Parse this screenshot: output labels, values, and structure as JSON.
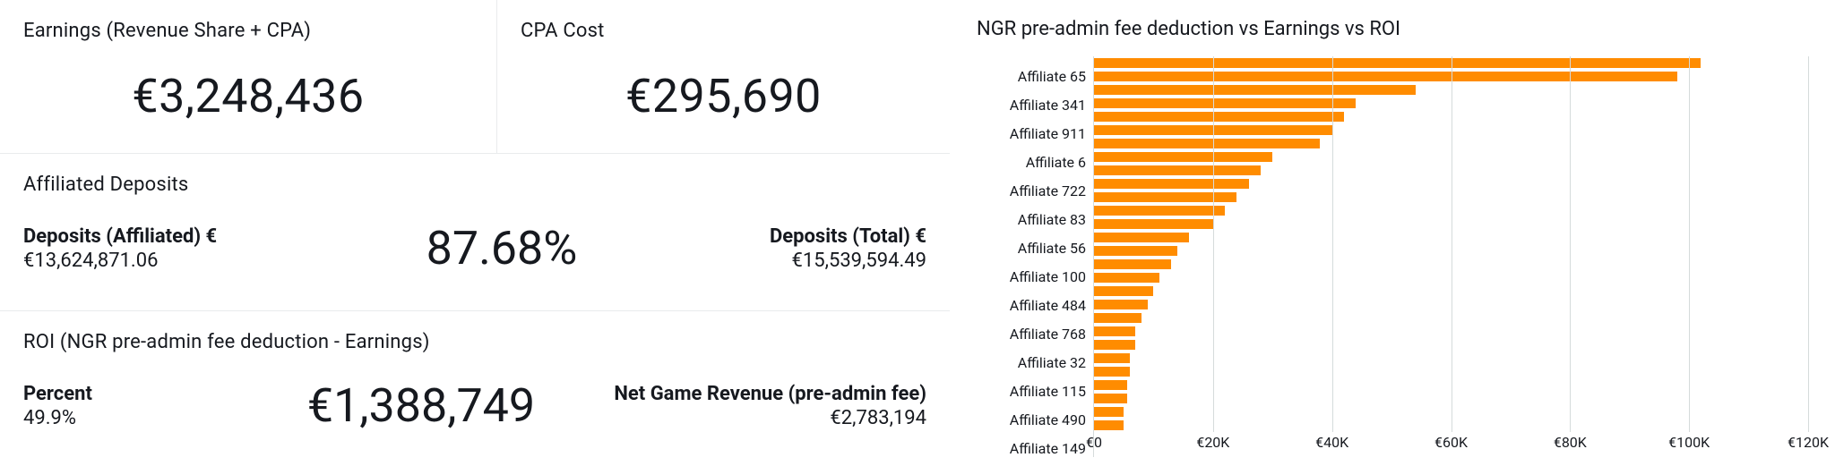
{
  "cards": {
    "earnings": {
      "title": "Earnings (Revenue Share + CPA)",
      "value": "€3,248,436"
    },
    "cpa": {
      "title": "CPA Cost",
      "value": "€295,690"
    }
  },
  "deposits": {
    "title": "Affiliated Deposits",
    "affiliated_label": "Deposits (Affiliated) €",
    "affiliated_value": "€13,624,871.06",
    "percent": "87.68%",
    "total_label": "Deposits (Total) €",
    "total_value": "€15,539,594.49"
  },
  "roi": {
    "title": "ROI (NGR pre-admin fee deduction - Earnings)",
    "percent_label": "Percent",
    "percent_value": "49.9%",
    "amount": "€1,388,749",
    "ngr_label": "Net Game Revenue (pre-admin fee)",
    "ngr_value": "€2,783,194"
  },
  "chart_title": "NGR pre-admin fee deduction vs Earnings vs ROI",
  "chart_data": {
    "type": "bar",
    "orientation": "horizontal",
    "title": "NGR pre-admin fee deduction vs Earnings vs ROI",
    "xlabel": "",
    "ylabel": "",
    "xlim": [
      0,
      120000
    ],
    "x_ticks": [
      0,
      20000,
      40000,
      60000,
      80000,
      100000,
      120000
    ],
    "x_tick_labels": [
      "€0",
      "€20K",
      "€40K",
      "€60K",
      "€80K",
      "€100K",
      "€120K"
    ],
    "y_tick_labels": [
      "Affiliate 65",
      "Affiliate 341",
      "Affiliate 911",
      "Affiliate 6",
      "Affiliate 722",
      "Affiliate 83",
      "Affiliate 56",
      "Affiliate 100",
      "Affiliate 484",
      "Affiliate 768",
      "Affiliate 32",
      "Affiliate 115",
      "Affiliate 490",
      "Affiliate 149"
    ],
    "categories": [
      "",
      "Affiliate 65",
      "",
      "Affiliate 341",
      "",
      "Affiliate 911",
      "",
      "Affiliate 6",
      "",
      "Affiliate 722",
      "",
      "Affiliate 83",
      "",
      "Affiliate 56",
      "",
      "Affiliate 100",
      "",
      "Affiliate 484",
      "",
      "Affiliate 768",
      "",
      "Affiliate 32",
      "",
      "Affiliate 115",
      "",
      "Affiliate 490",
      "",
      "Affiliate 149"
    ],
    "values": [
      102000,
      98000,
      54000,
      44000,
      42000,
      40000,
      38000,
      30000,
      28000,
      26000,
      24000,
      22000,
      20000,
      16000,
      14000,
      13000,
      11000,
      10000,
      9000,
      8000,
      7000,
      7000,
      6000,
      6000,
      5500,
      5500,
      5000,
      5000
    ],
    "color": "#ff8c00"
  }
}
